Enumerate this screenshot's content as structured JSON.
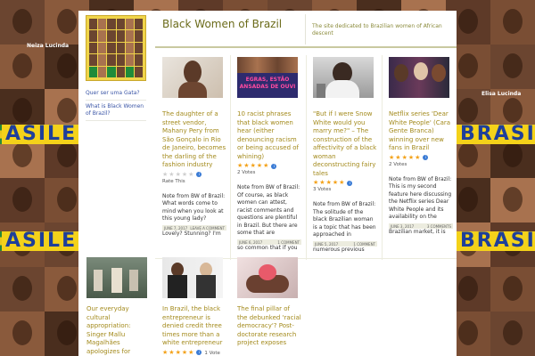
{
  "background": {
    "band_text_left": "ASILEI",
    "band_text_right": "BRASIL",
    "photo_caption_1": "Neiza Lucinda",
    "photo_caption_2": "Elisa Lucinda"
  },
  "header": {
    "site_title": "Black Women of Brazil",
    "tagline": "The site dedicated to Brazilian women of African descent"
  },
  "sidebar": {
    "items": [
      {
        "label": "Quer ser uma Gata?"
      },
      {
        "label": "What is Black Women of Brazil?"
      }
    ]
  },
  "posts": [
    {
      "title": "The daughter of a street vendor, Mahany Pery from São Gonçalo in Rio de Janeiro, becomes the darling of the fashion industry",
      "rating_label": "Rate This",
      "excerpt": "Note from BW of Brazil: What words come to mind when you look at this young lady?",
      "date": "JUNE 7, 2017",
      "comment": "LEAVE A COMMENT",
      "more": "Lovely? Stunning? I'm"
    },
    {
      "title": "10 racist phrases that black women hear (either denouncing racism or being accused of whining)",
      "thumb_text": "EGRAS, ESTÃO ANSADAS DE OUVI",
      "votes": "2 Votes",
      "excerpt": "Note from BW of Brazil: Of course, as black women can attest, racist comments and questions are plentiful in Brazil. But there are some that are",
      "date": "JUNE 6, 2017",
      "comment": "1 COMMENT",
      "more": "so common that if you"
    },
    {
      "title": "\"But if I were Snow White would you marry me?\" – The construction of the affectivity of a black woman deconstructing fairy tales",
      "votes": "3 Votes",
      "excerpt": "Note from BW of Brazil: The solitude of the black Brazilian woman is a topic that has been approached in",
      "date": "JUNE 5, 2017",
      "comment": "1 COMMENT",
      "more": "numerous previous"
    },
    {
      "title": "Netflix series 'Dear White People' (Cara Gente Branca) winning over new fans in Brazil",
      "votes": "2 Votes",
      "excerpt": "Note from BW of Brazil: This is my second feature here discussing the Netflix series Dear White People and its availability on the",
      "date": "JUNE 3, 2017",
      "comment": "3 COMMENTS",
      "more": "Brazilian market, it is"
    },
    {
      "title": "Our everyday cultural appropriation: Singer Mallu Magalhães apologizes for"
    },
    {
      "title": "In Brazil, the black entrepreneur is denied credit three times more than a white entrepreneur",
      "votes": "1 Vote"
    },
    {
      "title": "The final pillar of the debunked 'racial democracy'? Post-doctorate research project exposes"
    }
  ]
}
